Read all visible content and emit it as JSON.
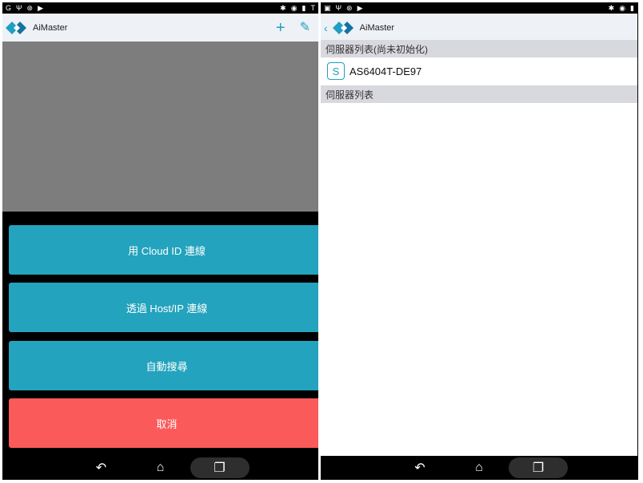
{
  "left": {
    "statusbar": {
      "left_icons": [
        "G",
        "Ψ",
        "⊛",
        "▶"
      ],
      "right_icons": [
        "✱",
        "◉",
        "▮",
        "T"
      ]
    },
    "appbar": {
      "title": "AiMaster",
      "add_icon": "+",
      "edit_icon": "✎"
    },
    "sheet": {
      "cloud_id": "用 Cloud ID 連線",
      "host_ip": "透過 Host/IP 連線",
      "auto_search": "自動搜尋",
      "cancel": "取消"
    },
    "navbar": {
      "back": "↶",
      "home": "⌂",
      "recents": "❐"
    }
  },
  "right": {
    "statusbar": {
      "left_icons": [
        "▣",
        "Ψ",
        "⊛",
        "▶"
      ],
      "right_icons": [
        "✱",
        "◉",
        "▮"
      ]
    },
    "appbar": {
      "back": "‹",
      "title": "AiMaster"
    },
    "sections": {
      "uninitialized": "伺服器列表(尚未初始化)",
      "servers": "伺服器列表"
    },
    "server_items": [
      {
        "name": "AS6404T-DE97",
        "icon": "S"
      }
    ],
    "navbar": {
      "back": "↶",
      "home": "⌂",
      "recents": "❐"
    }
  },
  "colors": {
    "accent": "#1e9fc4",
    "teal_button": "#23a3bd",
    "cancel_button": "#fb5a5a",
    "overlay": "#7d7d7d"
  }
}
